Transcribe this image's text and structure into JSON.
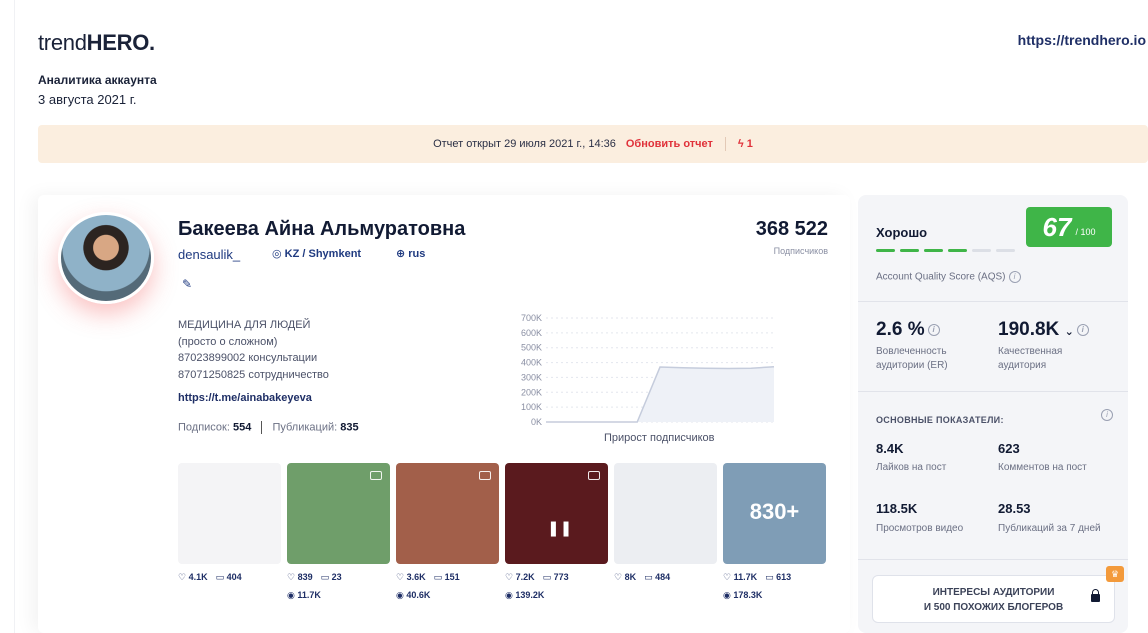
{
  "brand": {
    "logo_light": "trend",
    "logo_bold": "HERO.",
    "url": "https://trendhero.io"
  },
  "report": {
    "label": "Аналитика аккаунта",
    "date": "3 августа 2021 г."
  },
  "banner": {
    "opened_text": "Отчет открыт 29 июля 2021 г., 14:36",
    "refresh_label": "Обновить отчет",
    "credits": "1"
  },
  "profile": {
    "name": "Бакеева Айна Альмуратовна",
    "handle": "densaulik_",
    "location": "KZ / Shymkent",
    "language": "rus",
    "followers": "368 522",
    "followers_label": "Подписчиков",
    "bio": [
      "МЕДИЦИНА ДЛЯ ЛЮДЕЙ",
      "(просто о сложном)",
      "87023899002 консультации",
      "87071250825 сотрудничество"
    ],
    "link": "https://t.me/ainabakeyeva",
    "following_label": "Подписок:",
    "following": "554",
    "posts_label": "Публикаций:",
    "posts_count": "835"
  },
  "chart_data": {
    "type": "area",
    "title": "Прирост подписчиков",
    "yticks": [
      "700K",
      "600K",
      "500K",
      "400K",
      "300K",
      "200K",
      "100K",
      "0K"
    ],
    "ylim": [
      0,
      700000
    ],
    "x": [
      0,
      1,
      2,
      3,
      4,
      5,
      6,
      7,
      8,
      9,
      10
    ],
    "values": [
      0,
      0,
      0,
      0,
      0,
      370000,
      365000,
      362000,
      360000,
      362000,
      372000
    ]
  },
  "posts": [
    {
      "likes": "4.1K",
      "comments": "404",
      "views": "",
      "bg": "#f4f4f6",
      "badge": "",
      "video": false
    },
    {
      "likes": "839",
      "comments": "23",
      "views": "11.7K",
      "bg": "#6f9e6a",
      "badge": "",
      "video": true
    },
    {
      "likes": "3.6K",
      "comments": "151",
      "views": "40.6K",
      "bg": "#a25f4a",
      "badge": "",
      "video": true
    },
    {
      "likes": "7.2K",
      "comments": "773",
      "views": "139.2K",
      "bg": "#5a1a1e",
      "badge": "",
      "video": true
    },
    {
      "likes": "8K",
      "comments": "484",
      "views": "",
      "bg": "#eceef2",
      "badge": "",
      "video": false
    },
    {
      "likes": "11.7K",
      "comments": "613",
      "views": "178.3K",
      "bg": "#7f9db6",
      "badge": "830+",
      "video": false
    }
  ],
  "aqs": {
    "rating": "Хорошо",
    "score": "67",
    "max": "/ 100",
    "caption": "Account Quality Score (AQS)",
    "segments_on": 4,
    "segments_total": 6,
    "color": "#3fb548"
  },
  "engagement": {
    "value": "2.6 %",
    "label": "Вовлеченность аудитории (ER)"
  },
  "quality_audience": {
    "value": "190.8K",
    "label": "Качественная аудитория"
  },
  "metrics_title": "ОСНОВНЫЕ ПОКАЗАТЕЛИ:",
  "metrics": [
    {
      "value": "8.4K",
      "label": "Лайков на пост"
    },
    {
      "value": "623",
      "label": "Комментов на пост"
    },
    {
      "value": "118.5K",
      "label": "Просмотров видео"
    },
    {
      "value": "28.53",
      "label": "Публикаций за 7 дней"
    }
  ],
  "cta": {
    "line1": "ИНТЕРЕСЫ АУДИТОРИИ",
    "line2": "И 500 ПОХОЖИХ БЛОГЕРОВ"
  }
}
